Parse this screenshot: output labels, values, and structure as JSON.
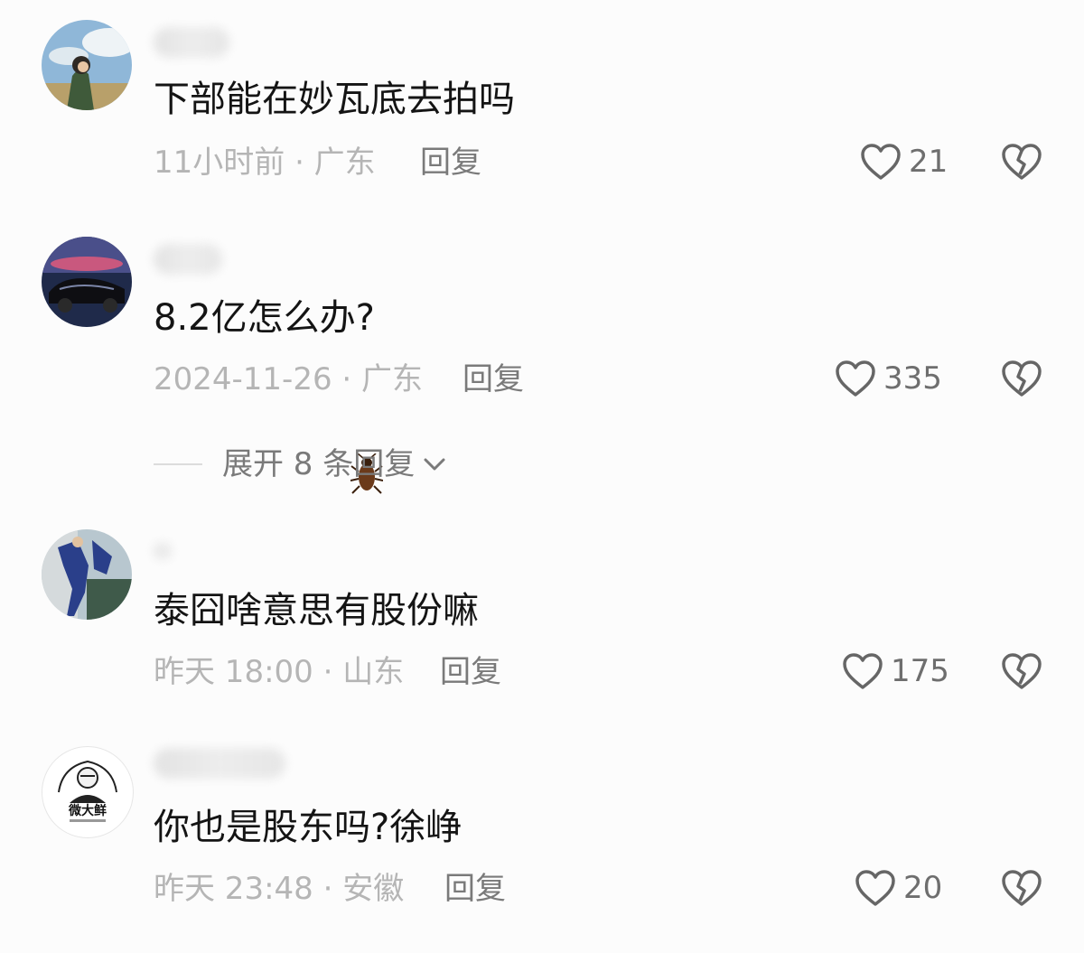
{
  "comments": [
    {
      "text": "下部能在妙瓦底去拍吗",
      "meta": "11小时前 · 广东",
      "reply": "回复",
      "likes": "21",
      "avatar_icon": "girl-sky-avatar"
    },
    {
      "text": "8.2亿怎么办?",
      "meta": "2024-11-26 · 广东",
      "reply": "回复",
      "likes": "335",
      "avatar_icon": "car-avatar",
      "badge_icon": "cockroach-icon"
    },
    {
      "text": "泰囧啥意思有股份嘛",
      "meta": "昨天 18:00 · 山东",
      "reply": "回复",
      "likes": "175",
      "avatar_icon": "figure-avatar"
    },
    {
      "text": "你也是股东吗?徐峥",
      "meta": "昨天 23:48 · 安徽",
      "reply": "回复",
      "likes": "20",
      "avatar_icon": "weidaxian-logo-avatar",
      "avatar_logo_text": "微大鲜"
    }
  ],
  "expand": {
    "label": "展开 8 条回复"
  },
  "colors": {
    "background": "#fcfcfc",
    "text": "#141414",
    "meta": "#b5b5b5",
    "reply": "#7a7a7a",
    "icon": "#666666"
  }
}
